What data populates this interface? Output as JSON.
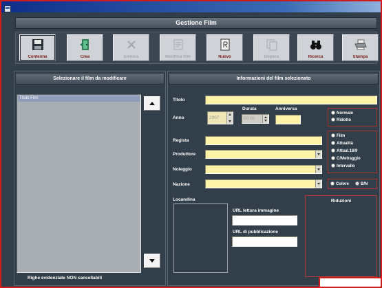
{
  "header": {
    "title": "Gestione Film"
  },
  "toolbar": {
    "buttons": [
      {
        "label": "Conferma",
        "icon": "floppy-disk-icon",
        "enabled": true
      },
      {
        "label": "Crea",
        "icon": "green-door-icon",
        "enabled": true
      },
      {
        "label": "Elimina",
        "icon": "delete-x-icon",
        "enabled": false
      },
      {
        "label": "Modifica film",
        "icon": "edit-icon",
        "enabled": false
      },
      {
        "label": "Nuovo",
        "icon": "document-icon",
        "enabled": true
      },
      {
        "label": "Duplica",
        "icon": "duplicate-icon",
        "enabled": false
      },
      {
        "label": "Ricerca",
        "icon": "binoculars-icon",
        "enabled": true
      },
      {
        "label": "Stampa",
        "icon": "printer-icon",
        "enabled": true
      }
    ]
  },
  "left_panel": {
    "title": "Selezionare il film da modificare",
    "list_header": "Titolo Film",
    "footer": "Righe evidenziate NON cancellabili"
  },
  "right_panel": {
    "title": "Informazioni del film selezionato",
    "titolo": {
      "label": "Titolo"
    },
    "anno": {
      "label": "Anno",
      "value": "2007"
    },
    "durata": {
      "label": "Durata",
      "value": "00:00"
    },
    "anniversario": {
      "label": "Anniversa"
    },
    "regista": {
      "label": "Regista"
    },
    "produttore": {
      "label": "Produttore"
    },
    "noleggio": {
      "label": "Noleggio"
    },
    "nazione": {
      "label": "Nazione"
    },
    "locandina": {
      "label": "Locandina"
    },
    "url_lettura": {
      "label": "URL lettura immagine"
    },
    "url_pubblicazione": {
      "label": "URL di pubblicazione"
    },
    "tariffa": {
      "options": [
        "Normale",
        "Ridotto"
      ]
    },
    "tipo": {
      "options": [
        "Film",
        "Attualità",
        "Attual.16/9",
        "C/Metraggio",
        "Intervallo"
      ]
    },
    "colore": {
      "options": [
        "Colore",
        "B/N"
      ],
      "selected_index": 1
    },
    "riduzioni": {
      "label": "Riduzioni"
    }
  },
  "colors": {
    "background": "#323e4a",
    "field": "#fff3a8",
    "accent": "#d21a1a",
    "title_bar": "#0e2f8a"
  }
}
